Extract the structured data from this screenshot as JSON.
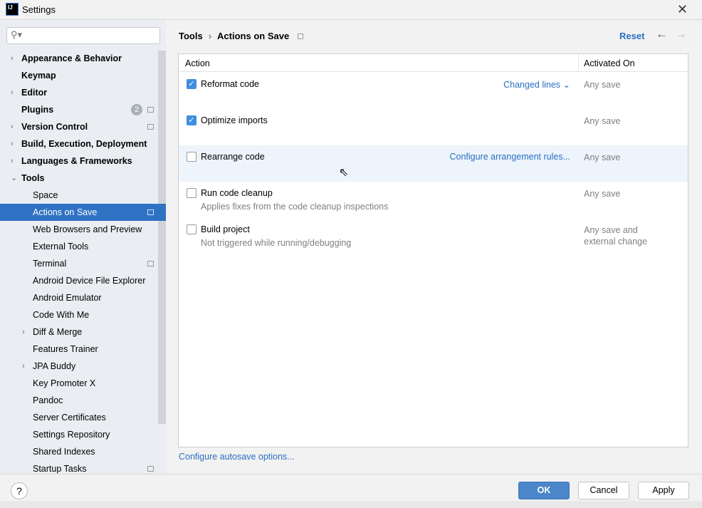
{
  "window": {
    "title": "Settings",
    "logo": "IJ"
  },
  "search": {
    "placeholder": "",
    "icon": "search-icon"
  },
  "sidebar": {
    "items": [
      {
        "label": "Appearance & Behavior",
        "level": 0,
        "chevron": "right"
      },
      {
        "label": "Keymap",
        "level": 0
      },
      {
        "label": "Editor",
        "level": 0,
        "chevron": "right"
      },
      {
        "label": "Plugins",
        "level": 0,
        "badge": "2",
        "pin": true
      },
      {
        "label": "Version Control",
        "level": 0,
        "chevron": "right",
        "pin": true
      },
      {
        "label": "Build, Execution, Deployment",
        "level": 0,
        "chevron": "right"
      },
      {
        "label": "Languages & Frameworks",
        "level": 0,
        "chevron": "right"
      },
      {
        "label": "Tools",
        "level": 0,
        "chevron": "down"
      },
      {
        "label": "Space",
        "level": 1
      },
      {
        "label": "Actions on Save",
        "level": 1,
        "pin": true,
        "selected": true
      },
      {
        "label": "Web Browsers and Preview",
        "level": 1
      },
      {
        "label": "External Tools",
        "level": 1
      },
      {
        "label": "Terminal",
        "level": 1,
        "pin": true
      },
      {
        "label": "Android Device File Explorer",
        "level": 1
      },
      {
        "label": "Android Emulator",
        "level": 1
      },
      {
        "label": "Code With Me",
        "level": 1
      },
      {
        "label": "Diff & Merge",
        "level": 1,
        "chevron": "right"
      },
      {
        "label": "Features Trainer",
        "level": 1
      },
      {
        "label": "JPA Buddy",
        "level": 1,
        "chevron": "right"
      },
      {
        "label": "Key Promoter X",
        "level": 1
      },
      {
        "label": "Pandoc",
        "level": 1
      },
      {
        "label": "Server Certificates",
        "level": 1
      },
      {
        "label": "Settings Repository",
        "level": 1
      },
      {
        "label": "Shared Indexes",
        "level": 1
      },
      {
        "label": "Startup Tasks",
        "level": 1,
        "pin": true
      }
    ]
  },
  "breadcrumb": {
    "parent": "Tools",
    "sep": "›",
    "current": "Actions on Save"
  },
  "header": {
    "reset": "Reset",
    "back": "←",
    "forward": "→"
  },
  "table": {
    "columns": [
      "Action",
      "Activated On"
    ],
    "rows": [
      {
        "label": "Reformat code",
        "checked": true,
        "action": "Changed lines ⌄",
        "activated": "Any save"
      },
      {
        "label": "Optimize imports",
        "checked": true,
        "activated": "Any save"
      },
      {
        "label": "Rearrange code",
        "checked": false,
        "action": "Configure arrangement rules...",
        "activated": "Any save",
        "hover": true
      },
      {
        "label": "Run code cleanup",
        "checked": false,
        "desc": "Applies fixes from the code cleanup inspections",
        "activated": "Any save"
      },
      {
        "label": "Build project",
        "checked": false,
        "desc": "Not triggered while running/debugging",
        "activated": "Any save and\nexternal change"
      }
    ]
  },
  "autosave_link": "Configure autosave options...",
  "footer": {
    "help": "?",
    "ok": "OK",
    "cancel": "Cancel",
    "apply": "Apply"
  },
  "colors": {
    "accent": "#2f72c3",
    "link": "#2a6fc0",
    "checkbox": "#3f8ee0",
    "hover_row": "#edf4fc"
  }
}
